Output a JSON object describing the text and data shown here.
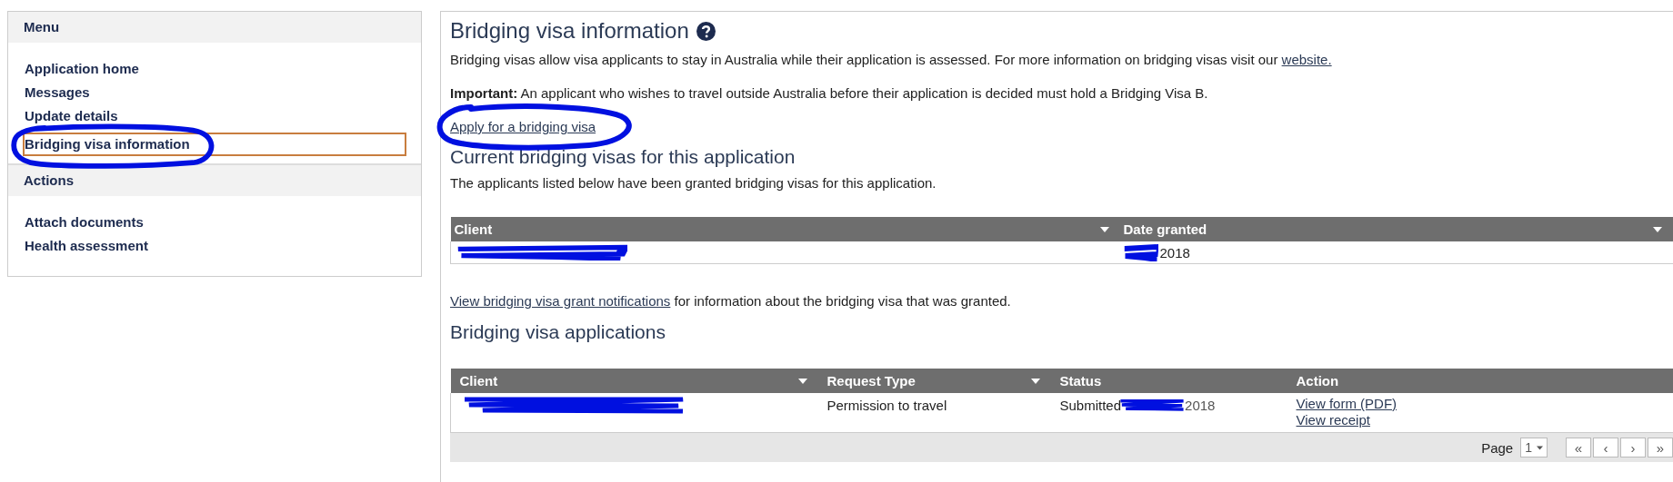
{
  "sidebar": {
    "sections": [
      {
        "title": "Menu",
        "items": [
          {
            "label": "Application home",
            "selected": false,
            "circled": false
          },
          {
            "label": "Messages",
            "selected": false,
            "circled": false
          },
          {
            "label": "Update details",
            "selected": false,
            "circled": false
          },
          {
            "label": "Bridging visa information",
            "selected": true,
            "circled": true
          }
        ]
      },
      {
        "title": "Actions",
        "items": [
          {
            "label": "Attach documents",
            "selected": false,
            "circled": false
          },
          {
            "label": "Health assessment",
            "selected": false,
            "circled": false
          }
        ]
      }
    ]
  },
  "main": {
    "title": "Bridging visa information",
    "intro": "Bridging visas allow visa applicants to stay in Australia while their application is assessed. For more information on bridging visas visit our",
    "intro_link": "website.",
    "important": "**Important:** An applicant who wishes to travel outside Australia before their application is decided must hold a Bridging Visa B.",
    "apply_link": {
      "label": "Apply for a bridging visa",
      "circled": true
    },
    "current": {
      "heading": "Current bridging visas for this application",
      "text": "The applicants listed below have been granted bridging visas for this application.",
      "columns": [
        {
          "label": "Client",
          "menu": true
        },
        {
          "label": "Date granted",
          "menu": true
        }
      ],
      "rows": [
        {
          "cells": [
            {
              "redacted": true
            },
            {
              "parts": [
                "2018"
              ],
              "redacted": true
            }
          ]
        }
      ]
    },
    "notifications_link": "View bridging visa grant notifications",
    "notifications_text": "for information about the bridging visa that was granted.",
    "applications": {
      "heading": "Bridging visa applications",
      "columns": [
        {
          "label": "Client",
          "menu": true
        },
        {
          "label": "Request Type",
          "menu": true
        },
        {
          "label": "Status",
          "menu": false
        },
        {
          "label": "Action",
          "menu": false
        }
      ],
      "rows": [
        {
          "cells": [
            {
              "redacted": true
            },
            {
              "parts": [
                "Permission to travel"
              ],
              "redacted": false
            },
            {
              "parts": [
                "Submitted",
                "2018"
              ],
              "redacted": true
            }
          ],
          "actions": [
            "View form (PDF)",
            "View receipt"
          ]
        }
      ]
    },
    "pager": {
      "label": "Page",
      "page": "1",
      "buttons": [
        "«",
        "‹",
        "›",
        "»"
      ]
    }
  }
}
